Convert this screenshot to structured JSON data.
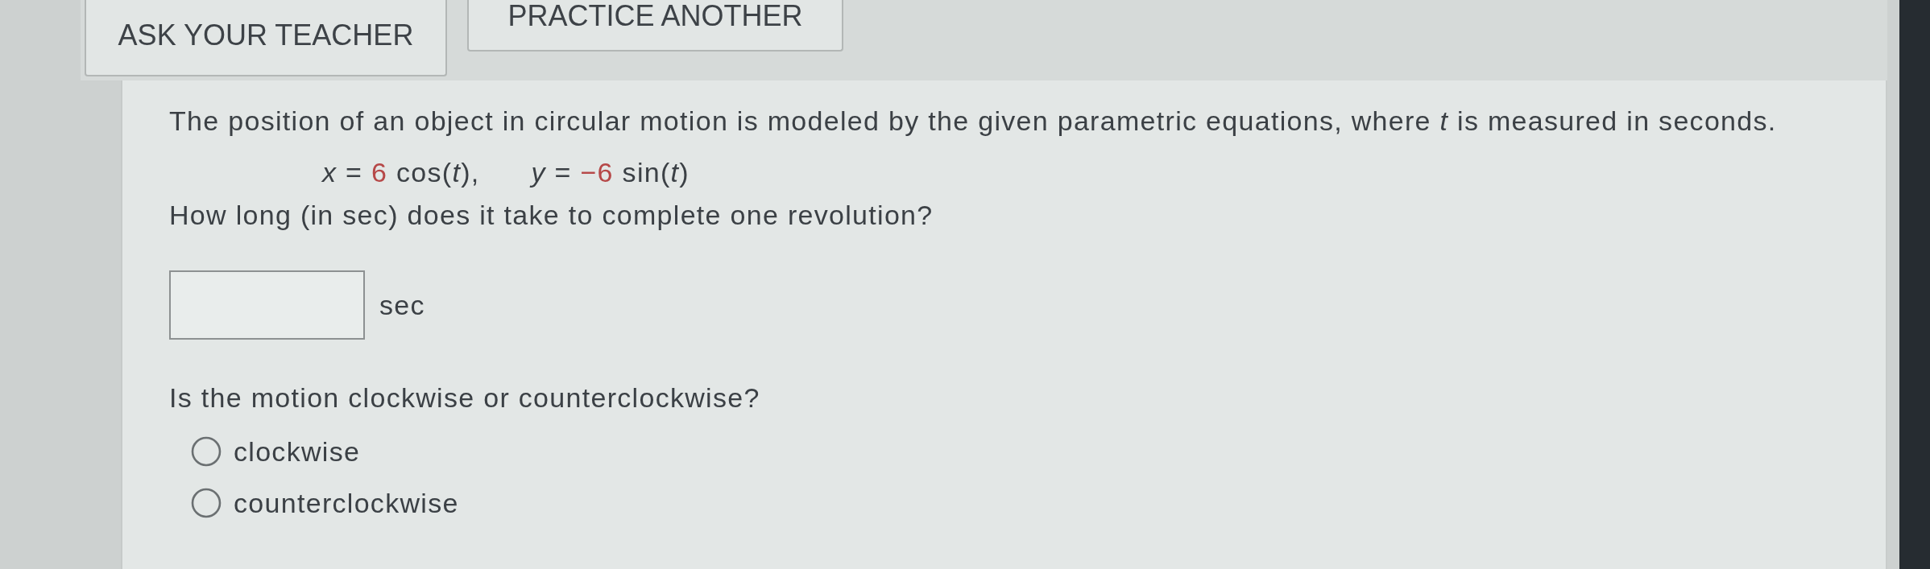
{
  "toolbar": {
    "buttons": [
      {
        "label": "ASK YOUR TEACHER"
      },
      {
        "label": "PRACTICE ANOTHER"
      }
    ]
  },
  "problem": {
    "intro": "The position of an object in circular motion is modeled by the given parametric equations, where *t* is measured in seconds.",
    "equations": [
      {
        "lhs": "*x* =",
        "coefficient": "6",
        "rhs": "cos(*t*),"
      },
      {
        "lhs": "*y* =",
        "coefficient": "−6",
        "rhs": "sin(*t*)"
      }
    ],
    "parts": [
      {
        "kind": "answer",
        "question": "How long (in sec) does it take to complete one revolution?",
        "unit": "sec"
      },
      {
        "kind": "choice",
        "question": "Is the motion clockwise or counterclockwise?",
        "options": [
          {
            "label": "clockwise",
            "selected": false
          },
          {
            "label": "counterclockwise",
            "selected": false
          }
        ]
      }
    ]
  }
}
